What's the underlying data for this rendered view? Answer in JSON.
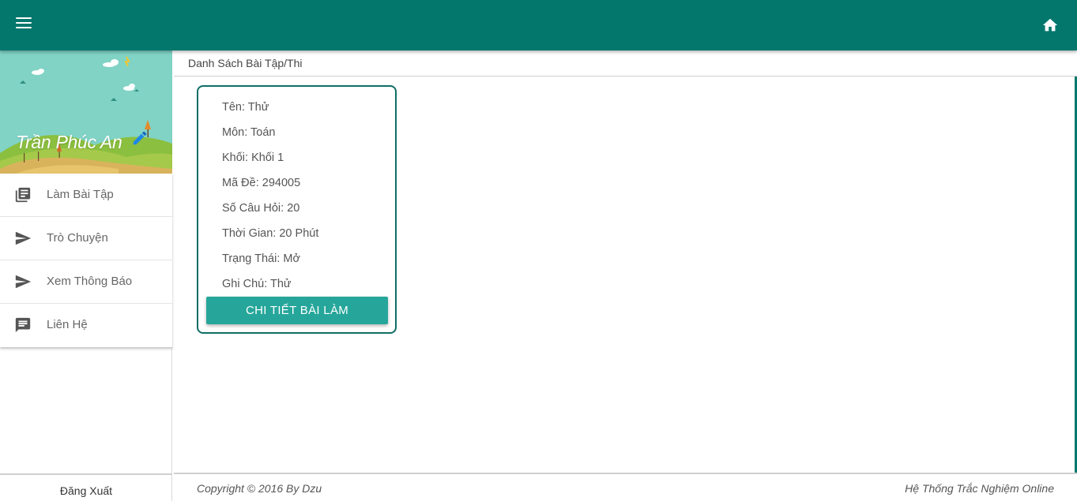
{
  "header": {
    "menu_icon": "hamburger-menu-icon",
    "home_icon": "home-icon",
    "color": "#04776d"
  },
  "profile": {
    "name": "Trần Phúc An",
    "edit_icon": "pencil-icon"
  },
  "sidebar": {
    "items": [
      {
        "label": "Làm Bài Tập",
        "icon": "library-books-icon"
      },
      {
        "label": "Trò Chuyện",
        "icon": "send-icon"
      },
      {
        "label": "Xem Thông Báo",
        "icon": "send-icon"
      },
      {
        "label": "Liên Hệ",
        "icon": "chat-icon"
      }
    ],
    "logout_label": "Đăng Xuất"
  },
  "breadcrumb": {
    "title": "Danh Sách Bài Tập/Thi"
  },
  "card": {
    "rows": [
      "Tên: Thử",
      "Môn: Toán",
      "Khối: Khối 1",
      "Mã Đề: 294005",
      "Số Câu Hỏi: 20",
      "Thời Gian: 20 Phút",
      "Trạng Thái: Mở",
      "Ghi Chú: Thử"
    ],
    "button_label": "CHI TIẾT BÀI LÀM",
    "button_color": "#26a69a"
  },
  "footer": {
    "copyright": "Copyright © 2016 By Dzu",
    "system_name": "Hệ Thống Trắc Nghiệm Online"
  }
}
